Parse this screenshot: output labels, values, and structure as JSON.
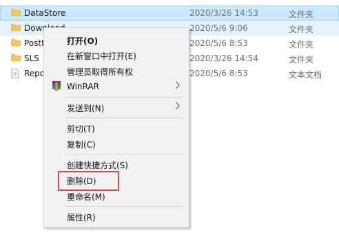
{
  "files": [
    {
      "name": "DataStore",
      "date": "2020/3/26 14:53",
      "type": "文件夹",
      "icon": "folder-icon",
      "state": "selected"
    },
    {
      "name": "Download",
      "date": "2020/5/6 9:06",
      "type": "文件夹",
      "icon": "folder-icon",
      "state": "hover"
    },
    {
      "name": "PostF",
      "date": "2020/5/6 8:53",
      "type": "文件夹",
      "icon": "folder-icon",
      "state": ""
    },
    {
      "name": "SLS",
      "date": "2020/3/26 14:54",
      "type": "文件夹",
      "icon": "folder-icon",
      "state": ""
    },
    {
      "name": "Repo",
      "date": "2020/5/6 8:53",
      "type": "文本文档",
      "icon": "text-file-icon",
      "state": ""
    }
  ],
  "context_menu": {
    "open": "打开(O)",
    "open_new_window": "在新窗口中打开(E)",
    "take_ownership": "管理员取得所有权",
    "winrar": "WinRAR",
    "send_to": "发送到(N)",
    "cut": "剪切(T)",
    "copy": "复制(C)",
    "create_shortcut": "创建快捷方式(S)",
    "delete": "删除(D)",
    "rename": "重命名(M)",
    "properties": "属性(R)"
  },
  "colors": {
    "selected_row": "#cce8ff",
    "hover_row": "#e5f3ff",
    "menu_bg": "#f2f2f2",
    "highlight_box": "#e04848",
    "folder": "#f4c85a"
  }
}
